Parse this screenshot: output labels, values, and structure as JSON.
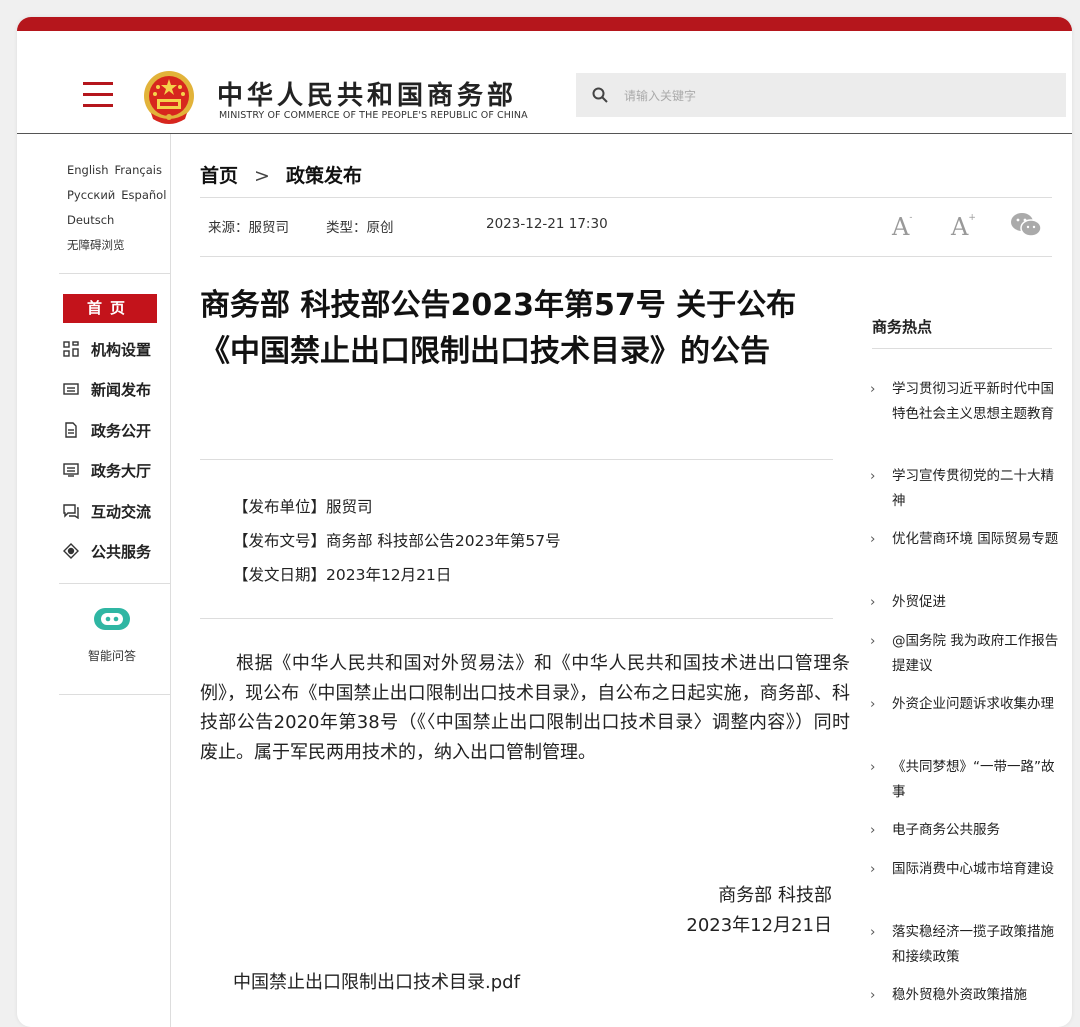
{
  "header": {
    "site_name": "中华人民共和国商务部",
    "site_name_en": "MINISTRY OF COMMERCE OF THE PEOPLE'S REPUBLIC OF CHINA",
    "search_placeholder": "请输入关键字"
  },
  "languages": {
    "row1": [
      "English",
      "Français"
    ],
    "row2": [
      "Русский",
      "Español"
    ],
    "row3": [
      "Deutsch"
    ],
    "accessible": "无障碍浏览"
  },
  "sidebar": {
    "home": "首页",
    "items": [
      {
        "label": "机构设置",
        "icon": "org-grid-icon"
      },
      {
        "label": "新闻发布",
        "icon": "news-icon"
      },
      {
        "label": "政务公开",
        "icon": "document-icon"
      },
      {
        "label": "政务大厅",
        "icon": "hall-icon"
      },
      {
        "label": "互动交流",
        "icon": "chat-icon"
      },
      {
        "label": "公共服务",
        "icon": "service-icon"
      }
    ],
    "ai_label": "智能问答"
  },
  "breadcrumb": {
    "home": "首页",
    "separator": ">",
    "current": "政策发布"
  },
  "meta": {
    "source": "来源：服贸司",
    "type": "类型：原创",
    "datetime": "2023-12-21 17:30"
  },
  "font_controls": {
    "decrease": "A",
    "increase": "A",
    "minus": "-",
    "plus": "+"
  },
  "article": {
    "title": "商务部 科技部公告2023年第57号 关于公布《中国禁止出口限制出口技术目录》的公告",
    "publisher": "【发布单位】服贸司",
    "doc_number": "【发布文号】商务部 科技部公告2023年第57号",
    "issue_date": "【发文日期】2023年12月21日",
    "body": "根据《中华人民共和国对外贸易法》和《中华人民共和国技术进出口管理条例》，现公布《中国禁止出口限制出口技术目录》，自公布之日起实施，商务部、科技部公告2020年第38号（《〈中国禁止出口限制出口技术目录〉调整内容》）同时废止。属于军民两用技术的，纳入出口管制管理。",
    "signature_org": "商务部 科技部",
    "signature_date": "2023年12月21日",
    "attachment": "中国禁止出口限制出口技术目录.pdf"
  },
  "hot": {
    "title": "商务热点",
    "items": [
      "学习贯彻习近平新时代中国特色社会主义思想主题教育",
      "学习宣传贯彻党的二十大精神",
      "优化营商环境 国际贸易专题",
      "外贸促进",
      "@国务院 我为政府工作报告提建议",
      "外资企业问题诉求收集办理",
      "《共同梦想》“一带一路”故事",
      "电子商务公共服务",
      "国际消费中心城市培育建设",
      "落实稳经济一揽子政策措施和接续政策",
      "稳外贸稳外资政策措施"
    ]
  },
  "colors": {
    "brand_red": "#b5161c"
  }
}
